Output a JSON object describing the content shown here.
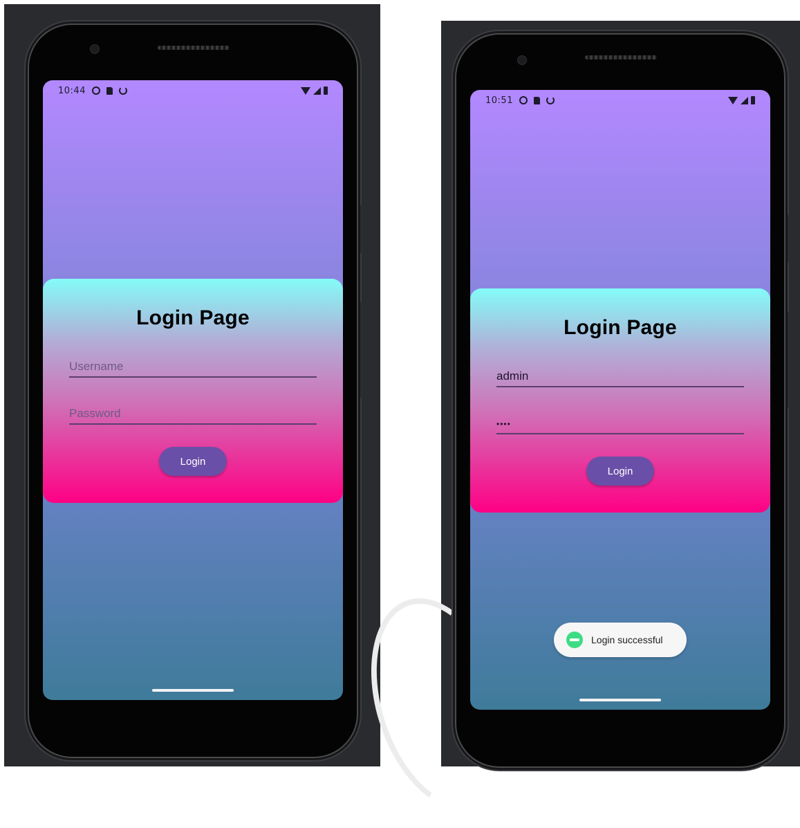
{
  "screens": [
    {
      "status": {
        "time": "10:44"
      },
      "card": {
        "title": "Login Page",
        "username": {
          "value": "",
          "placeholder": "Username"
        },
        "password": {
          "value": "",
          "placeholder": "Password"
        },
        "login_label": "Login"
      }
    },
    {
      "status": {
        "time": "10:51"
      },
      "card": {
        "title": "Login Page",
        "username": {
          "value": "admin",
          "placeholder": "Username"
        },
        "password": {
          "value": "••••",
          "placeholder": "Password"
        },
        "login_label": "Login"
      },
      "toast": {
        "text": "Login successful"
      }
    }
  ],
  "icons": {
    "status_left": [
      "sync-icon",
      "sd-card-icon",
      "power-icon"
    ],
    "status_right": [
      "wifi-icon",
      "signal-icon",
      "battery-icon"
    ]
  },
  "colors": {
    "screen_top": "#b388ff",
    "screen_bottom": "#3f7b9a",
    "card_top": "#84fbf8",
    "card_bottom": "#ff0084",
    "button": "#6a4fa8",
    "toast_icon": "#3ddc84"
  }
}
